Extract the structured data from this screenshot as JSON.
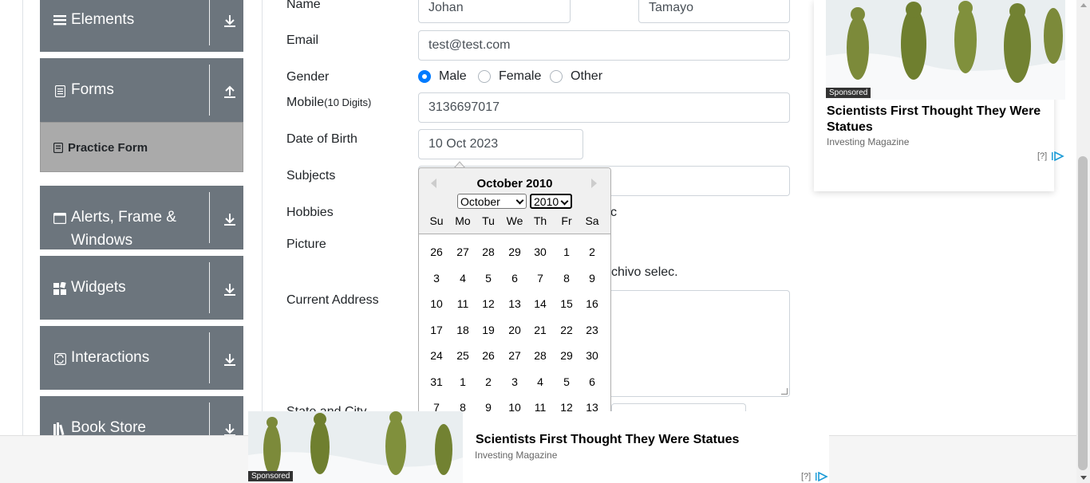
{
  "sidebar": {
    "groups": [
      {
        "label": "Elements",
        "icon": "menu-icon",
        "arrow": "down"
      },
      {
        "label": "Forms",
        "icon": "document-icon",
        "arrow": "up"
      },
      {
        "label": "Alerts, Frame & Windows",
        "icon": "window-icon",
        "arrow": "down"
      },
      {
        "label": "Widgets",
        "icon": "widgets-icon",
        "arrow": "down"
      },
      {
        "label": "Interactions",
        "icon": "interactions-icon",
        "arrow": "down"
      },
      {
        "label": "Book Store",
        "icon": "books-icon",
        "arrow": "down"
      }
    ],
    "active_item": "Practice Form"
  },
  "form": {
    "name_label": "Name",
    "first_name": "Johan",
    "last_name": "Tamayo",
    "email_label": "Email",
    "email": "test@test.com",
    "gender_label": "Gender",
    "gender_options": [
      "Male",
      "Female",
      "Other"
    ],
    "gender_selected": "Male",
    "mobile_label": "Mobile",
    "mobile_hint": "(10 Digits)",
    "mobile": "3136697017",
    "dob_label": "Date of Birth",
    "dob": "10 Oct 2023",
    "subjects_label": "Subjects",
    "hobbies_label": "Hobbies",
    "hobbies_fragment": "c",
    "picture_label": "Picture",
    "picture_fragment": "chivo selec.",
    "address_label": "Current Address",
    "state_fragment": "State and City"
  },
  "datepicker": {
    "title": "October 2010",
    "month": "October",
    "year": "2010",
    "weekdays": [
      "Su",
      "Mo",
      "Tu",
      "We",
      "Th",
      "Fr",
      "Sa"
    ],
    "weeks": [
      [
        "26",
        "27",
        "28",
        "29",
        "30",
        "1",
        "2"
      ],
      [
        "3",
        "4",
        "5",
        "6",
        "7",
        "8",
        "9"
      ],
      [
        "10",
        "11",
        "12",
        "13",
        "14",
        "15",
        "16"
      ],
      [
        "17",
        "18",
        "19",
        "20",
        "21",
        "22",
        "23"
      ],
      [
        "24",
        "25",
        "26",
        "27",
        "28",
        "29",
        "30"
      ],
      [
        "31",
        "1",
        "2",
        "3",
        "4",
        "5",
        "6"
      ],
      [
        "7",
        "8",
        "9",
        "10",
        "11",
        "12",
        "13"
      ]
    ]
  },
  "ads": {
    "right": {
      "badge": "Sponsored",
      "title": "Scientists First Thought They Were Statues",
      "source": "Investing Magazine",
      "info": "[?]"
    },
    "bottom": {
      "badge": "Sponsored",
      "title": "Scientists First Thought They Were Statues",
      "source": "Investing Magazine",
      "info": "[?]"
    }
  },
  "colors": {
    "sidebar_bg": "#6c757d",
    "active_item_bg": "#aaaaaa",
    "radio_accent": "#007bff",
    "input_border": "#ced4da"
  }
}
